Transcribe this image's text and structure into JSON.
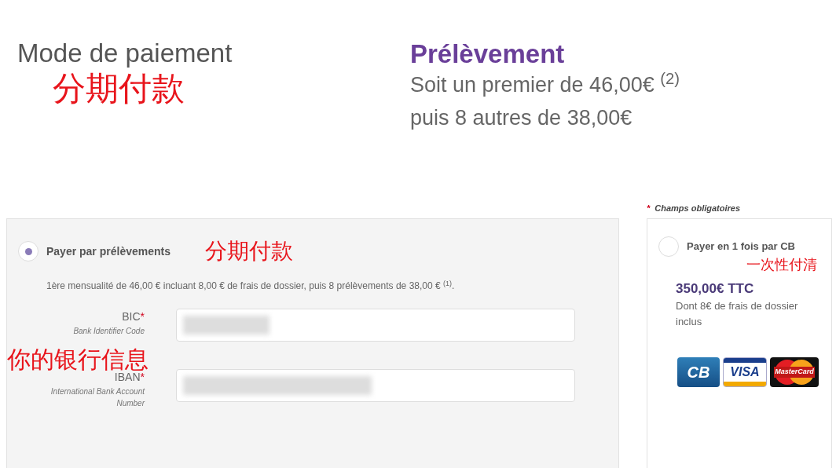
{
  "header": {
    "title": "Mode de paiement",
    "annotation": "分期付款"
  },
  "summary": {
    "title": "Prélèvement",
    "lines": [
      "Soit un premier de 46,00€ $^{(2)}$",
      "puis 8 autres de 38,00€"
    ]
  },
  "installment": {
    "label": "Payer par prélèvements",
    "selected": true,
    "annotation": "分期付款",
    "description": "1ère mensualité de 46,00 € incluant 8,00 € de frais de dossier, puis 8 prélèvements de 38,00 € $^{(1)}$.",
    "fields_annotation": "你的银行信息",
    "fields": [
      {
        "label": "BIC",
        "hint": "Bank Identifier Code"
      },
      {
        "label": "IBAN",
        "hint": "International Bank Account Number"
      }
    ]
  },
  "required_mark": "*",
  "required_note": "Champs obligatoires",
  "single": {
    "label": "Payer en 1 fois par CB",
    "selected": false,
    "annotation": "一次性付清",
    "price": "350,00€ TTC",
    "note": "Dont 8€ de frais de dossier inclus",
    "cards": [
      {
        "kind": "cb",
        "label": "CB"
      },
      {
        "kind": "visa",
        "label": "VISA"
      },
      {
        "kind": "mastercard",
        "label": "MasterCard"
      }
    ]
  }
}
